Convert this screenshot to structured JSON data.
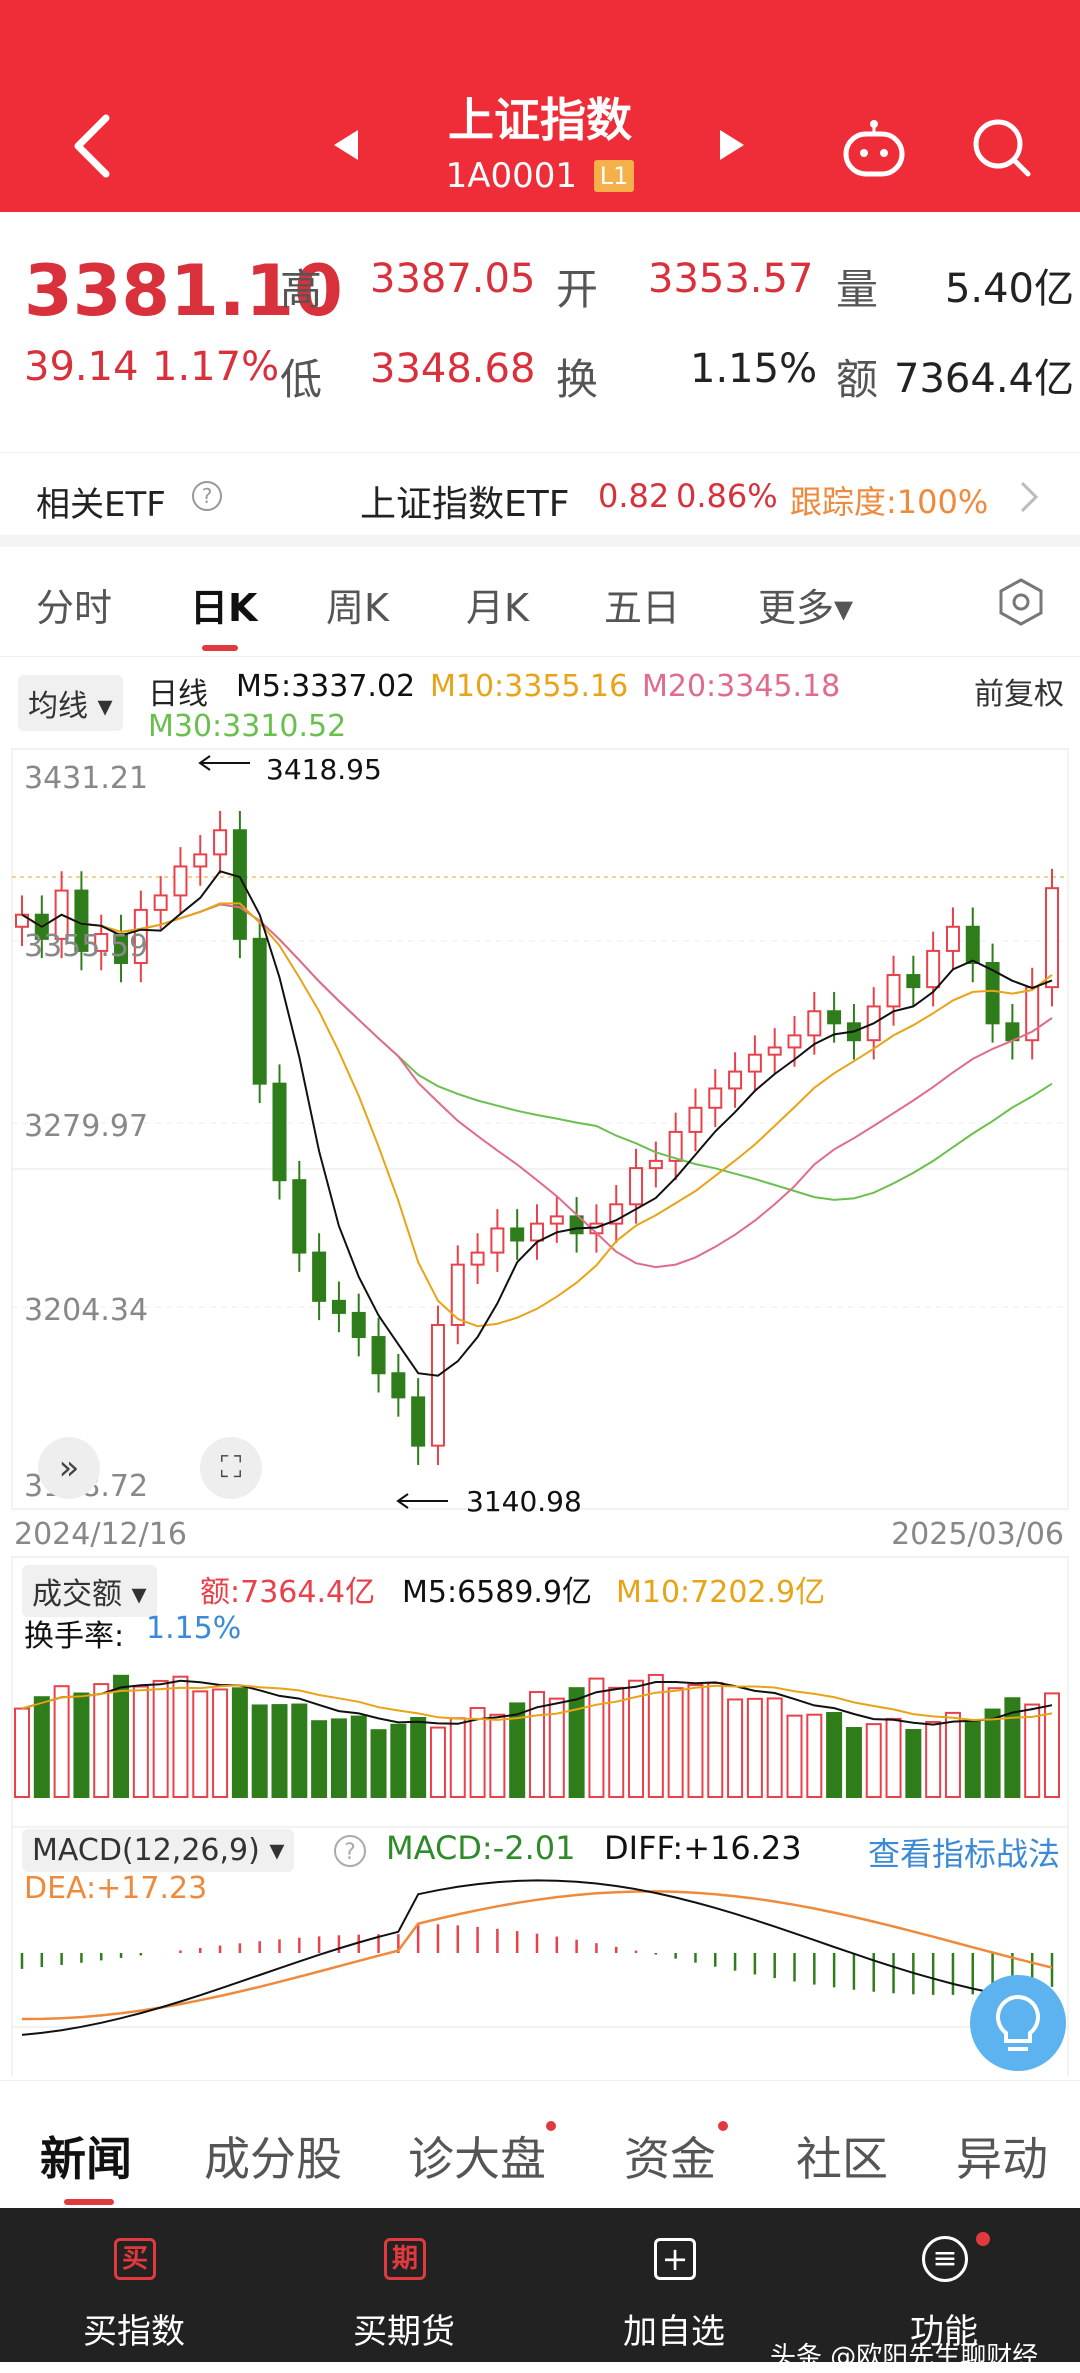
{
  "header": {
    "title": "上证指数",
    "code": "1A0001",
    "level_badge": "L1",
    "icons": [
      "back-arrow-icon",
      "prev-triangle-icon",
      "next-triangle-icon",
      "robot-icon",
      "search-icon"
    ]
  },
  "quote": {
    "price": "3381.10",
    "change": "39.14",
    "change_pct": "1.17%",
    "high_label": "高",
    "high": "3387.05",
    "open_label": "开",
    "open": "3353.57",
    "volume_label": "量",
    "volume": "5.40亿",
    "low_label": "低",
    "low": "3348.68",
    "turnover_label": "换",
    "turnover": "1.15%",
    "amount_label": "额",
    "amount": "7364.4亿"
  },
  "etf": {
    "label": "相关ETF",
    "help_icon": "question-icon",
    "name": "上证指数ETF",
    "price": "0.82",
    "pct": "0.86%",
    "tracking": "跟踪度:100%"
  },
  "tabs": {
    "items": [
      "分时",
      "日K",
      "周K",
      "月K",
      "五日",
      "更多▾"
    ],
    "active": "日K",
    "settings_icon": "hexagon-settings-icon"
  },
  "kline": {
    "ma_selector": "均线 ▾",
    "period": "日线",
    "m5": "M5:3337.02",
    "m10": "M10:3355.16",
    "m20": "M20:3345.18",
    "m30": "M30:3310.52",
    "adjust": "前复权",
    "y_labels": [
      "3431.21",
      "3355.59",
      "3279.97",
      "3204.34",
      "3128.72"
    ],
    "high_mark": "3418.95",
    "low_mark": "3140.98",
    "date_start": "2024/12/16",
    "date_end": "2025/03/06",
    "colors": {
      "up": "#e8414a",
      "down": "#2e7d1a",
      "m5": "#111111",
      "m10": "#e8a317",
      "m20": "#e06b8a",
      "m30": "#6ac04f"
    }
  },
  "volume": {
    "selector": "成交额 ▾",
    "amount": "额:7364.4亿",
    "m5": "M5:6589.9亿",
    "m10": "M10:7202.9亿",
    "turnover_label": "换手率:",
    "turnover": "1.15%"
  },
  "macd": {
    "selector": "MACD(12,26,9) ▾",
    "macd": "MACD:-2.01",
    "diff": "DIFF:+16.23",
    "dea": "DEA:+17.23",
    "strategy_link": "查看指标战法"
  },
  "news_tabs": {
    "items": [
      "新闻",
      "成分股",
      "诊大盘",
      "资金",
      "社区",
      "异动"
    ],
    "active": "新闻"
  },
  "footer": {
    "items": [
      {
        "label": "买指数",
        "icon": "buy-badge-icon",
        "glyph": "买"
      },
      {
        "label": "买期货",
        "icon": "futures-badge-icon",
        "glyph": "期"
      },
      {
        "label": "加自选",
        "icon": "plus-box-icon",
        "glyph": "+"
      },
      {
        "label": "功能",
        "icon": "menu-circle-icon",
        "glyph": "≡"
      }
    ],
    "watermark": "头条 @欧阳先生聊财经"
  }
}
